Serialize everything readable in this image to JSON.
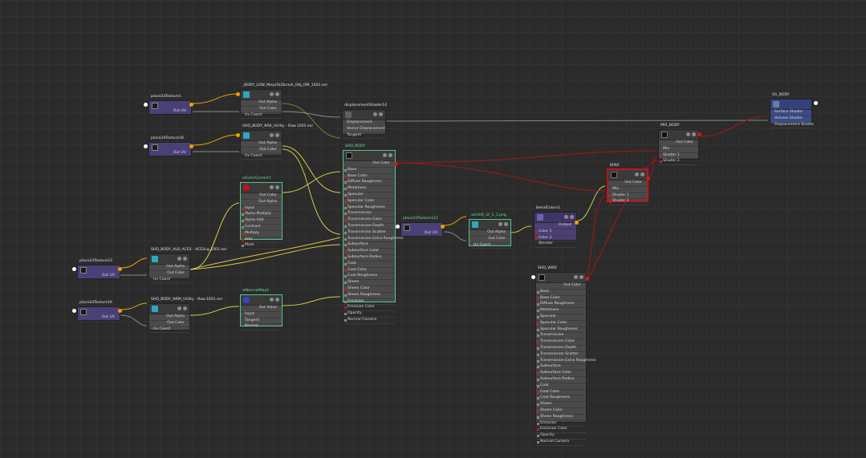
{
  "nodes": {
    "place2d_1": {
      "title": "place2dTexture1",
      "out": "Out UV"
    },
    "file_a": {
      "title": "_BODY_LOW_MayaToZbrush_Obj_DM_1001.exr",
      "out_alpha": "Out Alpha",
      "out_color": "Out Color",
      "in_uv": "Uv Coord"
    },
    "disp": {
      "title": "displacementShader14",
      "rows": [
        "Displacement",
        "Vector Displacement",
        "Tangent"
      ]
    },
    "sg_body": {
      "title": "SG_BODY",
      "rows": [
        "Surface Shader",
        "Volume Shader",
        "Displacement Shader"
      ]
    },
    "place2d_18": {
      "title": "place2dTexture18",
      "out": "Out UV"
    },
    "file_b": {
      "title": "SHD_BODY_NSK_Utility - Raw.1001.exr",
      "out_alpha": "Out Alpha",
      "out_color": "Out Color",
      "in_uv": "Uv Coord"
    },
    "mix_body": {
      "title": "MIX_BODY",
      "out": "Out Color",
      "rows": [
        "Mix",
        "Shader 1",
        "Shader 2"
      ]
    },
    "shd_body": {
      "title": "SHD_BODY",
      "out": "Out Color",
      "rows": [
        "Base",
        "Base Color",
        "Diffuse Roughness",
        "Metalness",
        "Specular",
        "Specular Color",
        "Specular Roughness",
        "Transmission",
        "Transmission Color",
        "Transmission Depth",
        "Transmission Scatter",
        "Transmission Extra Roughness",
        "Subsurface",
        "Subsurface Color",
        "Subsurface Radius",
        "Coat",
        "Coat Color",
        "Coat Roughness",
        "Sheen",
        "Sheen Color",
        "Sheen Roughness",
        "Emission",
        "Emission Color",
        "Opacity",
        "Normal Camera"
      ]
    },
    "wire": {
      "title": "WIRE",
      "out": "Out Color",
      "rows": [
        "Mix",
        "Shader 1",
        "Shader 2"
      ]
    },
    "color_correct": {
      "title": "aiColorCorrect1",
      "outs": [
        "Out Color",
        "Out Alpha"
      ],
      "rows": [
        "Input",
        "Alpha Multiply",
        "Alpha Add",
        "Contrast",
        "Multiply",
        "Add",
        "Mask"
      ]
    },
    "place2d_122": {
      "title": "place2dTexture122",
      "out": "Out UV"
    },
    "file_c": {
      "title": "wireUV_LY_1_1.png",
      "out_alpha": "Out Alpha",
      "out_color": "Out Color",
      "in_uv": "Uv Coord"
    },
    "blend": {
      "title": "blendColors1",
      "out": "Output",
      "rows": [
        "Color 1",
        "Color 2",
        "Blender"
      ]
    },
    "place2d_23": {
      "title": "place2dTexture23",
      "out": "Out UV"
    },
    "file_d": {
      "title": "SHD_BODY_ALB_ACES - ACEScg.1001.exr",
      "out_alpha": "Out Alpha",
      "out_color": "Out Color",
      "in_uv": "Uv Coord"
    },
    "normal_map": {
      "title": "aiNormalMap1",
      "out": "Out Value",
      "rows": [
        "Input",
        "Tangent",
        "Normal"
      ]
    },
    "place2d_19": {
      "title": "place2dTexture19",
      "out": "Out UV"
    },
    "file_e": {
      "title": "SHD_BODY_NRM_Utility - Raw.1001.exr",
      "out_alpha": "Out Alpha",
      "out_color": "Out Color",
      "in_uv": "Uv Coord"
    },
    "shd_wire": {
      "title": "SHD_WIRE",
      "out": "Out Color",
      "rows": [
        "Base",
        "Base Color",
        "Diffuse Roughness",
        "Metalness",
        "Specular",
        "Specular Color",
        "Specular Roughness",
        "Transmission",
        "Transmission Color",
        "Transmission Depth",
        "Transmission Scatter",
        "Transmission Extra Roughness",
        "Subsurface",
        "Subsurface Color",
        "Subsurface Radius",
        "Coat",
        "Coat Color",
        "Coat Roughness",
        "Sheen",
        "Sheen Color",
        "Sheen Roughness",
        "Emission",
        "Emission Color",
        "Opacity",
        "Normal Camera"
      ]
    }
  },
  "colors": {
    "background": "#2b2b2b",
    "node": "#4a4a4a",
    "place2d": "#4b3f78",
    "wire_yellow": "#d8c84a",
    "wire_red": "#a01818",
    "wire_gray": "#8a8a8a",
    "selected_green": "#52c48a",
    "selected_red": "#c0161a"
  }
}
